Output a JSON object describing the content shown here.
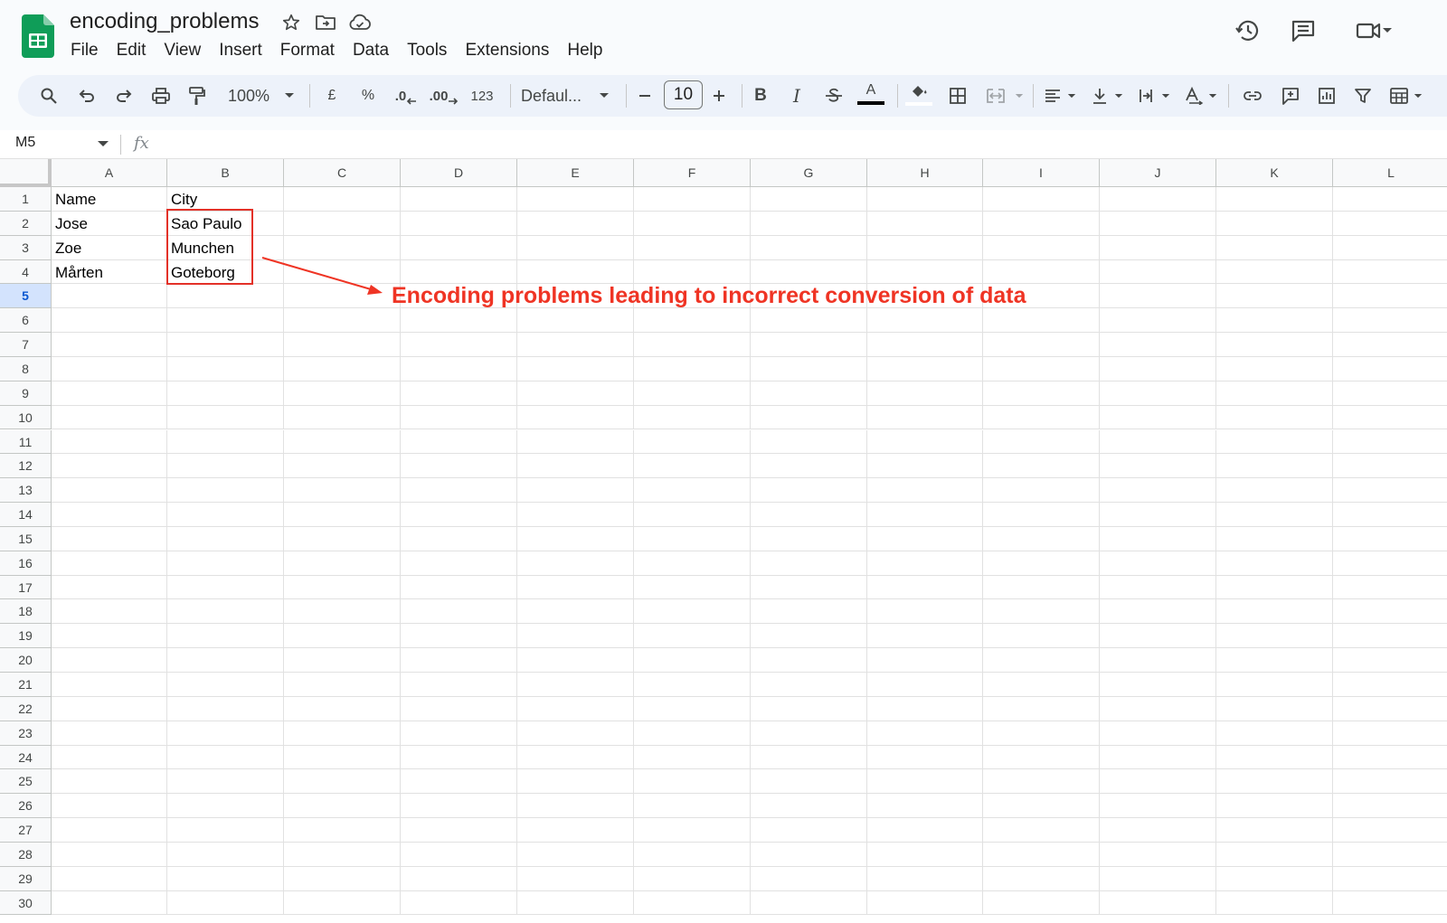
{
  "app": {
    "title": "encoding_problems",
    "menus": [
      "File",
      "Edit",
      "View",
      "Insert",
      "Format",
      "Data",
      "Tools",
      "Extensions",
      "Help"
    ]
  },
  "toolbar": {
    "zoom": "100%",
    "currency": "£",
    "percent": "%",
    "decrease_decimal": ".0",
    "increase_decimal": ".00",
    "number_format": "123",
    "font": "Defaul...",
    "font_size": "10",
    "bold": "B",
    "italic": "I",
    "text_color_glyph": "A"
  },
  "formula_bar": {
    "cell_ref": "M5",
    "fx": "fx",
    "value": ""
  },
  "sheet": {
    "columns": [
      "A",
      "B",
      "C",
      "D",
      "E",
      "F",
      "G",
      "H",
      "I",
      "J",
      "K",
      "L"
    ],
    "rows": [
      "1",
      "2",
      "3",
      "4",
      "5",
      "6",
      "7",
      "8",
      "9",
      "10",
      "11",
      "12",
      "13",
      "14",
      "15",
      "16",
      "17",
      "18",
      "19",
      "20",
      "21",
      "22",
      "23",
      "24",
      "25",
      "26",
      "27",
      "28",
      "29",
      "30"
    ],
    "selected_row": "5",
    "cells": {
      "A1": "Name",
      "B1": "City",
      "A2": "Jose",
      "B2": "Sao Paulo",
      "A3": "Zoe",
      "B3": "Munchen",
      "A4": "Mårten",
      "B4": "Goteborg"
    }
  },
  "annotation": {
    "text": "Encoding problems leading to incorrect conversion of data",
    "color": "#ef3424"
  },
  "colors": {
    "brand_green": "#0f9d58",
    "toolbar_bg": "#edf2fa",
    "selection_blue": "#d3e3fd"
  }
}
